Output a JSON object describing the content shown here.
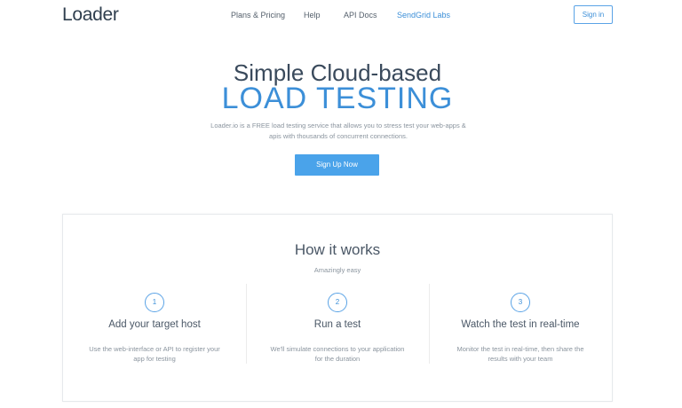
{
  "header": {
    "logo": "Loader",
    "nav": [
      "Plans & Pricing",
      "Help",
      "API Docs",
      "SendGrid Labs"
    ],
    "signin": "Sign in"
  },
  "hero": {
    "line1": "Simple Cloud-based",
    "line2": "LOAD TESTING",
    "description": "Loader.io is a FREE load testing service that allows you to stress test your web-apps & apis with thousands of concurrent connections.",
    "cta": "Sign Up Now"
  },
  "how": {
    "title": "How it works",
    "subtitle": "Amazingly easy",
    "steps": [
      {
        "num": "1",
        "title": "Add your target host",
        "desc": "Use the web-interface or API to register your app for testing"
      },
      {
        "num": "2",
        "title": "Run a test",
        "desc": "We'll simulate connections to your application for the duration"
      },
      {
        "num": "3",
        "title": "Watch the test in real-time",
        "desc": "Monitor the test in real-time, then share the results with your team"
      }
    ]
  },
  "colors": {
    "accent": "#3c8fd8",
    "button": "#4aa3ea",
    "text": "#3a4a5c"
  }
}
